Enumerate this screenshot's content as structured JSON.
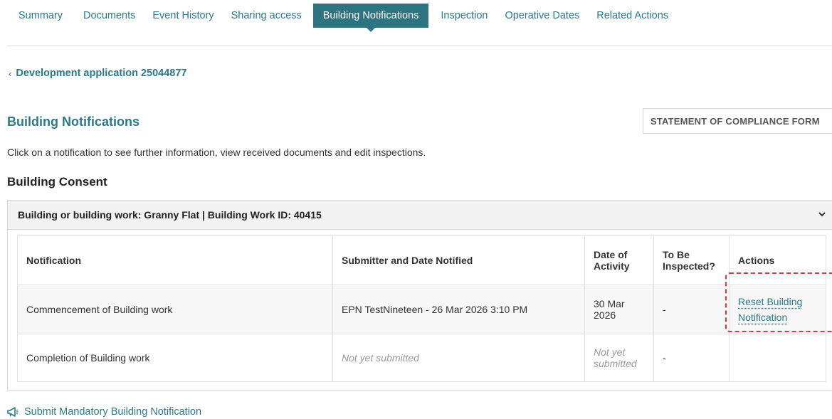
{
  "tabs": [
    {
      "label": "Summary"
    },
    {
      "label": "Documents"
    },
    {
      "label": "Event History"
    },
    {
      "label": "Sharing access"
    },
    {
      "label": "Building Notifications",
      "active": true
    },
    {
      "label": "Inspection"
    },
    {
      "label": "Operative Dates"
    },
    {
      "label": "Related Actions"
    }
  ],
  "back_link": {
    "label": "Development application 25044877",
    "icon": "chevron-left-icon"
  },
  "section": {
    "title": "Building Notifications",
    "soc_button": "STATEMENT OF COMPLIANCE FORM",
    "intro": "Click on a notification to see further information, view received documents and edit inspections."
  },
  "consent": {
    "title": "Building Consent",
    "accordion_header": "Building or building work: Granny Flat | Building Work ID: 40415",
    "chevron_icon": "chevron-down-icon"
  },
  "table": {
    "headers": {
      "notification": "Notification",
      "submitter": "Submitter and Date Notified",
      "date_line1": "Date of",
      "date_line2": "Activity",
      "inspect_line1": "To Be",
      "inspect_line2": "Inspected?",
      "actions": "Actions"
    },
    "rows": [
      {
        "notification": "Commencement of Building work",
        "submitter": "EPN TestNineteen - 26 Mar 2026 3:10 PM",
        "date_line1": "30 Mar",
        "date_line2": "2026",
        "to_be_inspected": "-",
        "action_line1": "Reset Building",
        "action_line2": "Notification"
      },
      {
        "notification": "Completion of Building work",
        "submitter": "Not yet submitted",
        "date_line1": "Not yet",
        "date_line2": "submitted",
        "to_be_inspected": "-"
      }
    ]
  },
  "submit_link": {
    "label": "Submit Mandatory Building Notification",
    "icon": "megaphone-icon"
  },
  "colors": {
    "accent": "#2b7a87",
    "active_tab": "#2d7380",
    "highlight": "#e5323b"
  }
}
